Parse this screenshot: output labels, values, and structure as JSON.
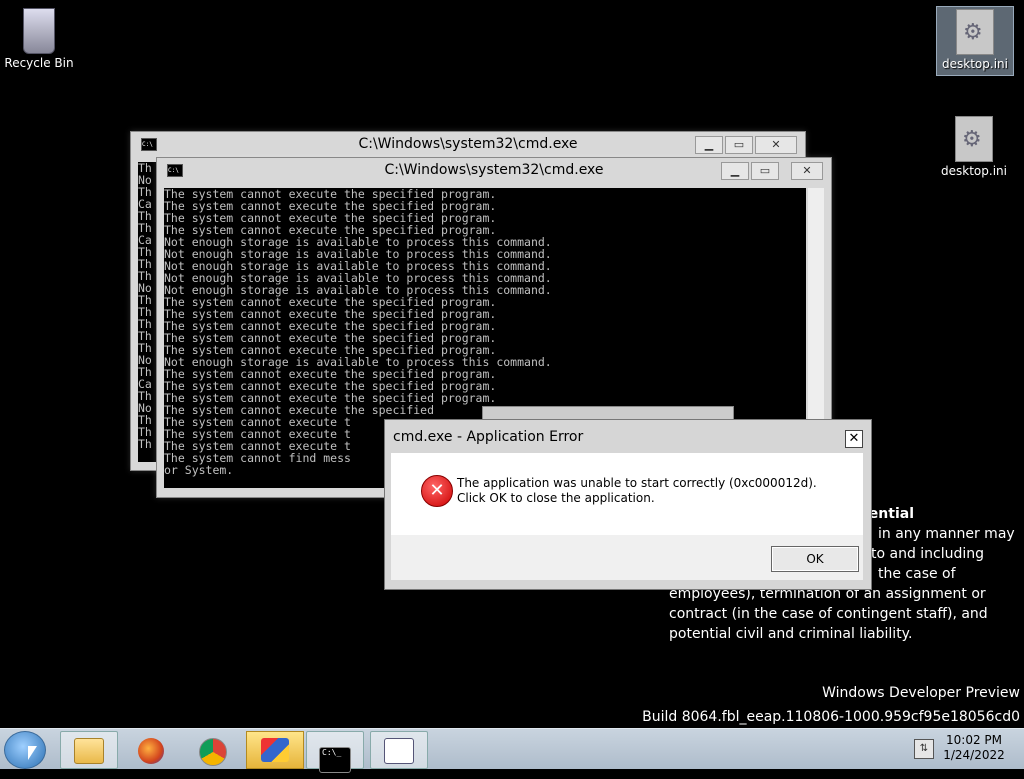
{
  "desktop": {
    "recycle_bin": "Recycle Bin",
    "ini_selected": "desktop.ini",
    "ini_other": "desktop.ini"
  },
  "watermark": {
    "title": "lential",
    "lines": [
      "in any manner may",
      "to and including",
      "the case of",
      "employees), termination of an assignment or",
      "contract (in the case of contingent staff), and",
      "potential civil and criminal liability."
    ],
    "build_name": "Windows Developer Preview",
    "build_number": "Build 8064.fbl_eeap.110806-1000.959cf95e18056cd0"
  },
  "back_console": {
    "title": "C:\\Windows\\system32\\cmd.exe",
    "fragments": "Th\nNo\nTh\nCa\nTh\nTh\nCa\nTh\nTh\nTh\nNo\nTh\nTh\nTh\nTh\nTh\nNo\nTh\nCa\nTh\nNo\nTh\nTh\nTh"
  },
  "front_console": {
    "title": "C:\\Windows\\system32\\cmd.exe",
    "output": "The system cannot execute the specified program.\nThe system cannot execute the specified program.\nThe system cannot execute the specified program.\nThe system cannot execute the specified program.\nNot enough storage is available to process this command.\nNot enough storage is available to process this command.\nNot enough storage is available to process this command.\nNot enough storage is available to process this command.\nNot enough storage is available to process this command.\nThe system cannot execute the specified program.\nThe system cannot execute the specified program.\nThe system cannot execute the specified program.\nThe system cannot execute the specified program.\nThe system cannot execute the specified program.\nNot enough storage is available to process this command.\nThe system cannot execute the specified program.\nThe system cannot execute the specified program.\nThe system cannot execute the specified program.\nThe system cannot execute the specified\nThe system cannot execute t\nThe system cannot execute t\nThe system cannot execute t\nThe system cannot find mess\nor System."
  },
  "dialog": {
    "title": "cmd.exe - Application Error",
    "message": "The application was unable to start correctly (0xc000012d). Click OK to close the application.",
    "ok_label": "OK",
    "close_glyph": "✕"
  },
  "taskbar": {
    "cmd_glyph": "C:\\_",
    "time": "10:02 PM",
    "date": "1/24/2022"
  }
}
